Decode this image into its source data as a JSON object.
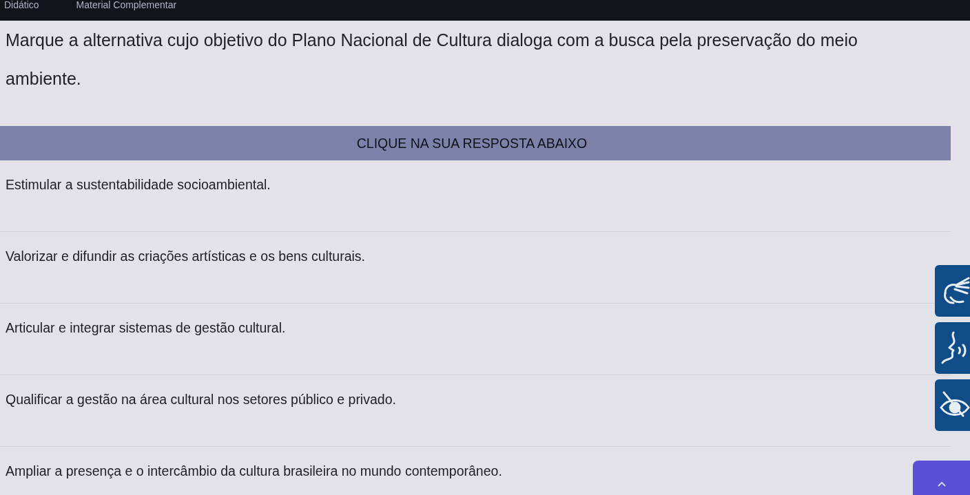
{
  "top_bar": {
    "links": [
      "Didático",
      "Material Complementar"
    ]
  },
  "question": {
    "text": "Marque a alternativa cujo objetivo do Plano Nacional de Cultura dialoga com a busca pela preservação do meio ambiente."
  },
  "banner": {
    "text": "CLIQUE NA SUA RESPOSTA ABAIXO"
  },
  "options": [
    {
      "text": "Estimular a sustentabilidade socioambiental.",
      "selected": false
    },
    {
      "text": "Valorizar e difundir as criações artísticas e os bens culturais.",
      "selected": false
    },
    {
      "text": "Articular e integrar sistemas de gestão cultural.",
      "selected": false
    },
    {
      "text": "Qualificar a gestão na área cultural nos setores público e privado.",
      "selected": false
    },
    {
      "text": "Ampliar a presença e o intercâmbio da cultura brasileira no mundo contemporâneo.",
      "selected": false
    }
  ]
}
